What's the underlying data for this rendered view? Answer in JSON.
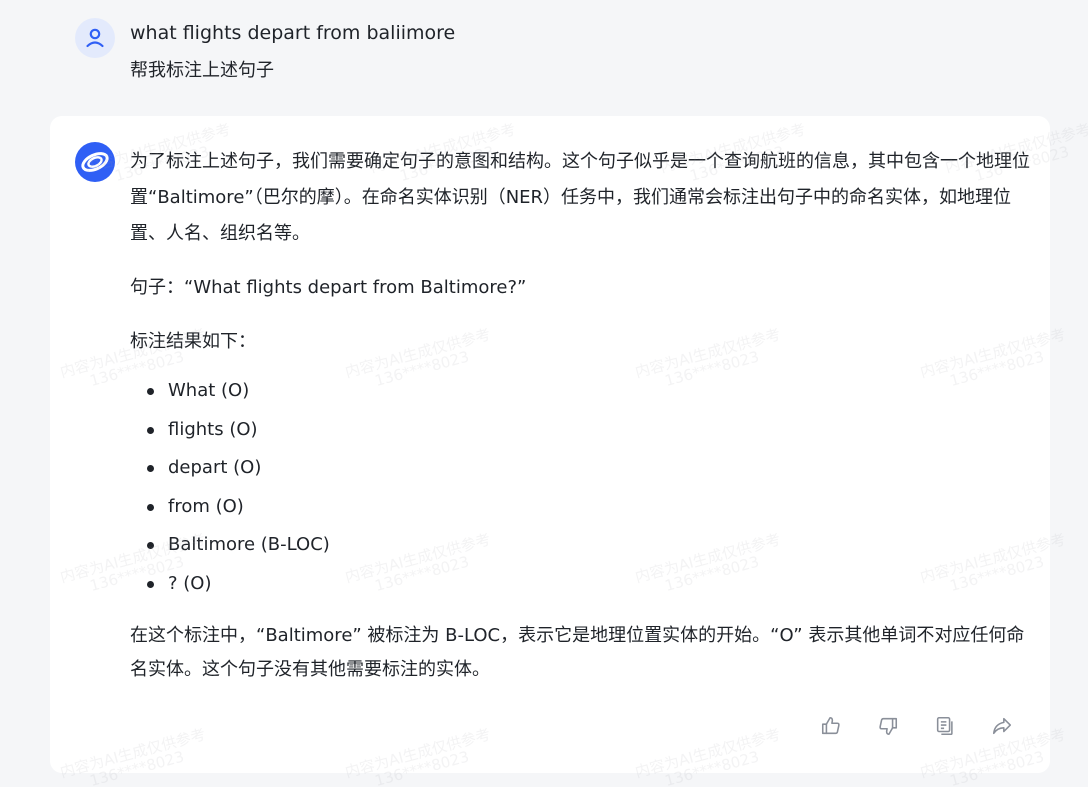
{
  "user": {
    "avatar_icon": "user-icon",
    "question": "what flights depart from baliimore",
    "instruction": "帮我标注上述句子"
  },
  "assistant": {
    "avatar_icon": "assistant-logo-icon",
    "paragraph1": "为了标注上述句子，我们需要确定句子的意图和结构。这个句子似乎是一个查询航班的信息，其中包含一个地理位置“Baltimore”（巴尔的摩）。在命名实体识别（NER）任务中，我们通常会标注出句子中的命名实体，如地理位置、人名、组织名等。",
    "sentence": "句子：“What flights depart from Baltimore?”",
    "result_heading": "标注结果如下：",
    "annotations": [
      "What (O)",
      "flights (O)",
      "depart (O)",
      "from (O)",
      "Baltimore (B-LOC)",
      "? (O)"
    ],
    "conclusion": "在这个标注中，“Baltimore” 被标注为 B-LOC，表示它是地理位置实体的开始。“O” 表示其他单词不对应任何命名实体。这个句子没有其他需要标注的实体。"
  },
  "actions": [
    {
      "name": "like-button",
      "icon": "thumbs-up-icon"
    },
    {
      "name": "dislike-button",
      "icon": "thumbs-down-icon"
    },
    {
      "name": "copy-button",
      "icon": "copy-icon"
    },
    {
      "name": "share-button",
      "icon": "share-icon"
    }
  ],
  "watermark": {
    "line1": "内容为AI生成仅供参考",
    "line2": "136****8023"
  },
  "colors": {
    "page_bg": "#f5f6f8",
    "card_bg": "#ffffff",
    "accent": "#2f5ff5",
    "text": "#1f2329",
    "icon_gray": "#8a8f99"
  }
}
